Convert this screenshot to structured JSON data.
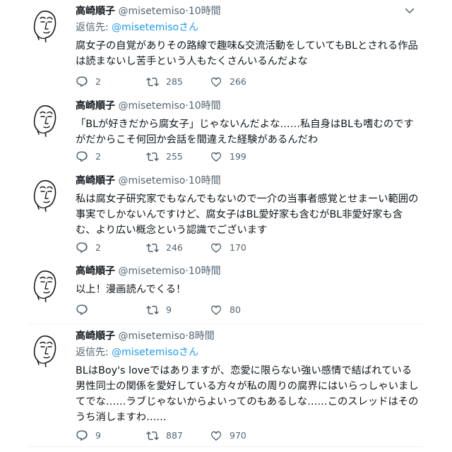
{
  "tweets": [
    {
      "name": "高崎順子",
      "handle": "@misetemiso",
      "dot": "·",
      "time": "10時間",
      "reply_prefix": "返信先:",
      "reply_mention": "@misetemisoさん",
      "text": "腐女子の自覚がありその路線で趣味&交流活動をしていてもBLとされる作品は読まないし苦手という人もたくさんいるんだよな",
      "replies": "2",
      "retweets": "285",
      "likes": "266"
    },
    {
      "name": "高崎順子",
      "handle": "@misetemiso",
      "dot": "·",
      "time": "10時間",
      "text": "「BLが好きだから腐女子」じゃないんだよな……私自身はBLも嗜むのですがだからこそ何回か会話を間違えた経験があるんだわ",
      "replies": "2",
      "retweets": "255",
      "likes": "199"
    },
    {
      "name": "高崎順子",
      "handle": "@misetemiso",
      "dot": "·",
      "time": "10時間",
      "text": "私は腐女子研究家でもなんでもないので一介の当事者感覚とせまーい範囲の事実でしかないんですけど、腐女子はBL愛好家も含むがBL非愛好家も含む、より広い概念という認識でございます",
      "replies": "2",
      "retweets": "246",
      "likes": "170"
    },
    {
      "name": "高崎順子",
      "handle": "@misetemiso",
      "dot": "·",
      "time": "10時間",
      "text": "以上！漫画読んでくる！",
      "replies": "",
      "retweets": "9",
      "likes": "80"
    },
    {
      "name": "高崎順子",
      "handle": "@misetemiso",
      "dot": "·",
      "time": "8時間",
      "reply_prefix": "返信先:",
      "reply_mention": "@misetemisoさん",
      "text": "BLはBoy's loveではありますが、恋愛に限らない強い感情で結ばれている男性同士の関係を愛好している方々が私の周りの腐界にはいらっしゃいましてでな……ラブじゃないからよいってのもあるしな……このスレッドはそのうち消しますわ……",
      "replies": "9",
      "retweets": "887",
      "likes": "970"
    }
  ],
  "colors": {
    "text": "#0f1419",
    "secondary": "#536471",
    "link": "#1d9bf0",
    "divider": "#eff3f4"
  },
  "icons": [
    "avatar-sketch",
    "more-caret-icon",
    "reply-icon",
    "retweet-icon",
    "like-icon"
  ]
}
